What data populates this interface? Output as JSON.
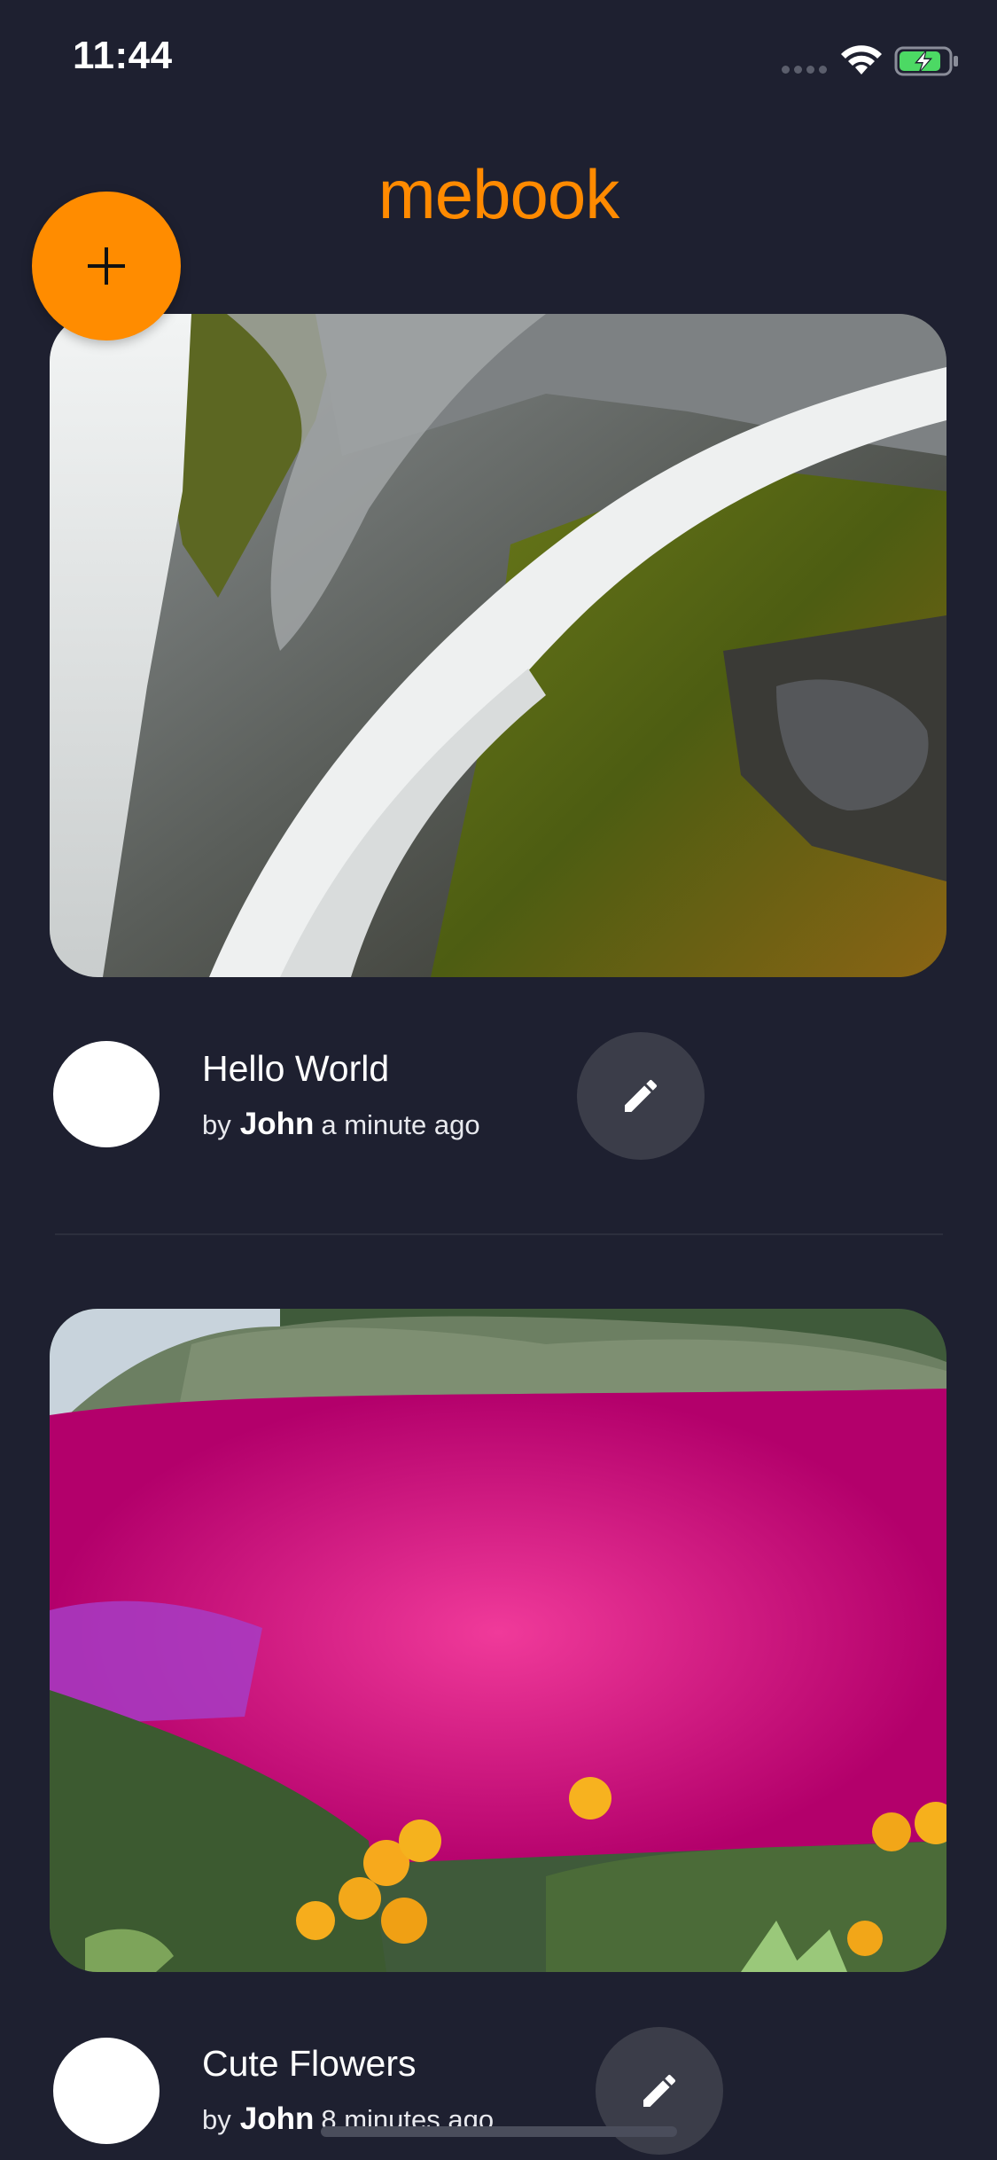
{
  "status_bar": {
    "time": "11:44",
    "signal_icon": "signal-dots-icon",
    "wifi_icon": "wifi-icon",
    "battery_icon": "battery-charging-icon",
    "battery_color": "#4cd964"
  },
  "header": {
    "title": "mebook",
    "title_color": "#ff8a00"
  },
  "fab": {
    "icon": "plus-icon",
    "color": "#ff8c00"
  },
  "posts": [
    {
      "image": "waterfall-photo",
      "title": "Hello World",
      "by_label": "by",
      "author": "John",
      "timestamp": "a minute ago",
      "edit_icon": "pencil-icon"
    },
    {
      "image": "flowers-photo",
      "title": "Cute Flowers",
      "by_label": "by",
      "author": "John",
      "timestamp": "8 minutes ago",
      "edit_icon": "pencil-icon"
    }
  ],
  "colors": {
    "background": "#1e2030",
    "accent": "#ff8c00",
    "edit_button": "#3b3d49"
  }
}
